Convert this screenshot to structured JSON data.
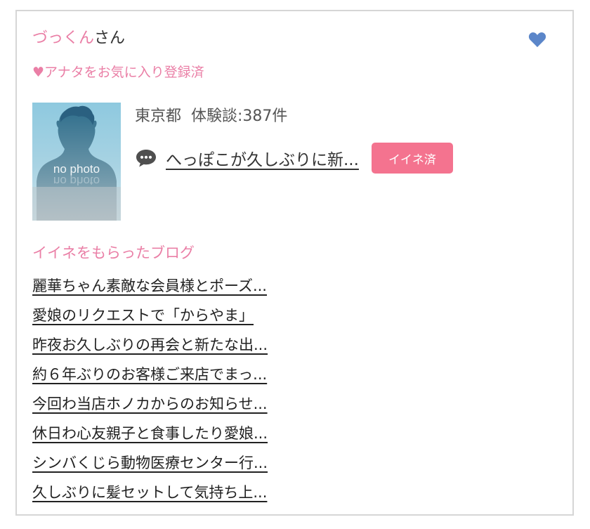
{
  "user": {
    "name": "づっくん",
    "honorific": "さん",
    "favorite_status": "♥アナタをお気に入り登録済"
  },
  "profile": {
    "photo_placeholder": "no photo",
    "location": "東京都",
    "review_count": "体験談:387件",
    "latest_review_title": "へっぽこが久しぶりに新...",
    "liked_label": "イイネ済"
  },
  "blog": {
    "heading": "イイネをもらったブログ",
    "items": [
      "麗華ちゃん素敵な会員様とポーズ...",
      "愛娘のリクエストで「からやま」",
      "昨夜お久しぶりの再会と新たな出...",
      "約６年ぶりのお客様ご来店でまっ...",
      "今回わ当店ホノカからのお知らせ...",
      "休日わ心友親子と食事したり愛娘...",
      "シンバくじら動物医療センター行...",
      "久しぶりに髪セットして気持ち上..."
    ]
  },
  "icons": {
    "heart": "heart-icon",
    "chat": "speech-bubble-icon"
  },
  "colors": {
    "pink_text": "#ea7fa6",
    "badge_bg": "#f4738f",
    "heart_blue": "#5b86c9",
    "border": "#d6d6d6"
  }
}
